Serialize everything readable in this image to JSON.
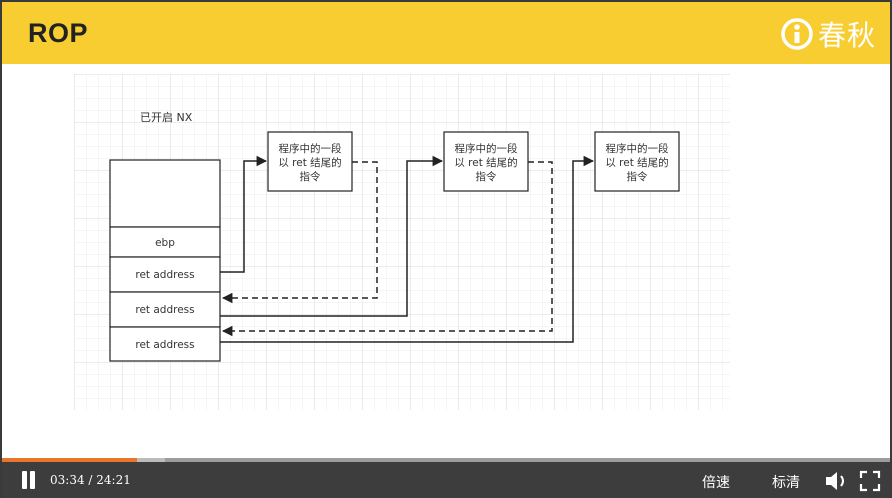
{
  "slide": {
    "title": "ROP",
    "brand_text": "春秋"
  },
  "diagram": {
    "nx_label": "已开启 NX",
    "stack_cells": [
      "ebp",
      "ret address",
      "ret address",
      "ret address"
    ],
    "gadget_lines": [
      "程序中的一段",
      "以 ret 结尾的",
      "指令"
    ]
  },
  "player": {
    "time": "03:34 / 24:21",
    "speed_label": "倍速",
    "quality_label": "标清",
    "progress": 0.152,
    "buffered": 0.183
  },
  "colors": {
    "header": "#f8cd32",
    "progress": "#e8752a"
  }
}
